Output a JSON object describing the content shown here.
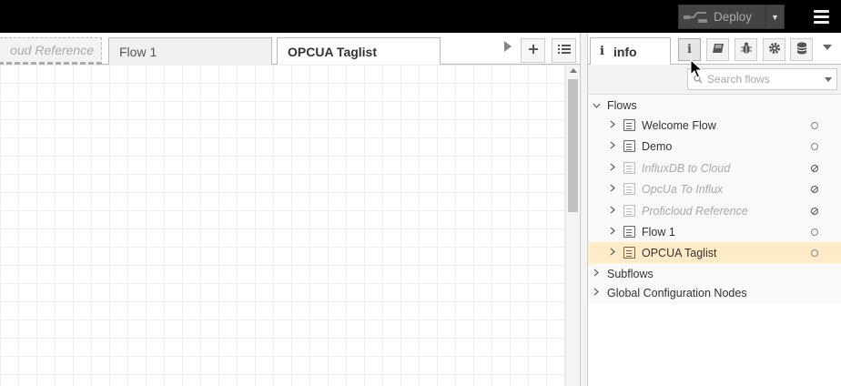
{
  "header": {
    "deploy_label": "Deploy",
    "deploy_icon": "deploy-icon",
    "menu_icon": "hamburger-menu-icon"
  },
  "workspace": {
    "tabs": [
      {
        "label": "oud Reference",
        "state": "disabled"
      },
      {
        "label": "Flow 1",
        "state": "normal"
      },
      {
        "label": "OPCUA Taglist",
        "state": "active"
      }
    ],
    "scroll_icon": "tab-scroll-right-icon",
    "add_tab_icon": "plus-icon",
    "list_flows_icon": "list-icon"
  },
  "sidebar": {
    "active_tab": {
      "label": "info",
      "icon": "info-icon"
    },
    "buttons": [
      "info-icon",
      "book-icon",
      "bug-icon",
      "gear-icon",
      "database-icon"
    ],
    "search": {
      "placeholder": "Search flows"
    },
    "tree": {
      "flows_header": "Flows",
      "flows": [
        {
          "label": "Welcome Flow",
          "disabled": false,
          "selected": false
        },
        {
          "label": "Demo",
          "disabled": false,
          "selected": false
        },
        {
          "label": "InfluxDB to Cloud",
          "disabled": true,
          "selected": false
        },
        {
          "label": "OpcUa To Influx",
          "disabled": true,
          "selected": false
        },
        {
          "label": "Proficloud Reference",
          "disabled": true,
          "selected": false
        },
        {
          "label": "Flow 1",
          "disabled": false,
          "selected": false
        },
        {
          "label": "OPCUA Taglist",
          "disabled": false,
          "selected": true
        }
      ],
      "subflows_header": "Subflows",
      "config_header": "Global Configuration Nodes"
    }
  },
  "colors": {
    "header_bg": "#000000",
    "selected_row": "#ffebc7",
    "deploy_bg": "#444444"
  }
}
